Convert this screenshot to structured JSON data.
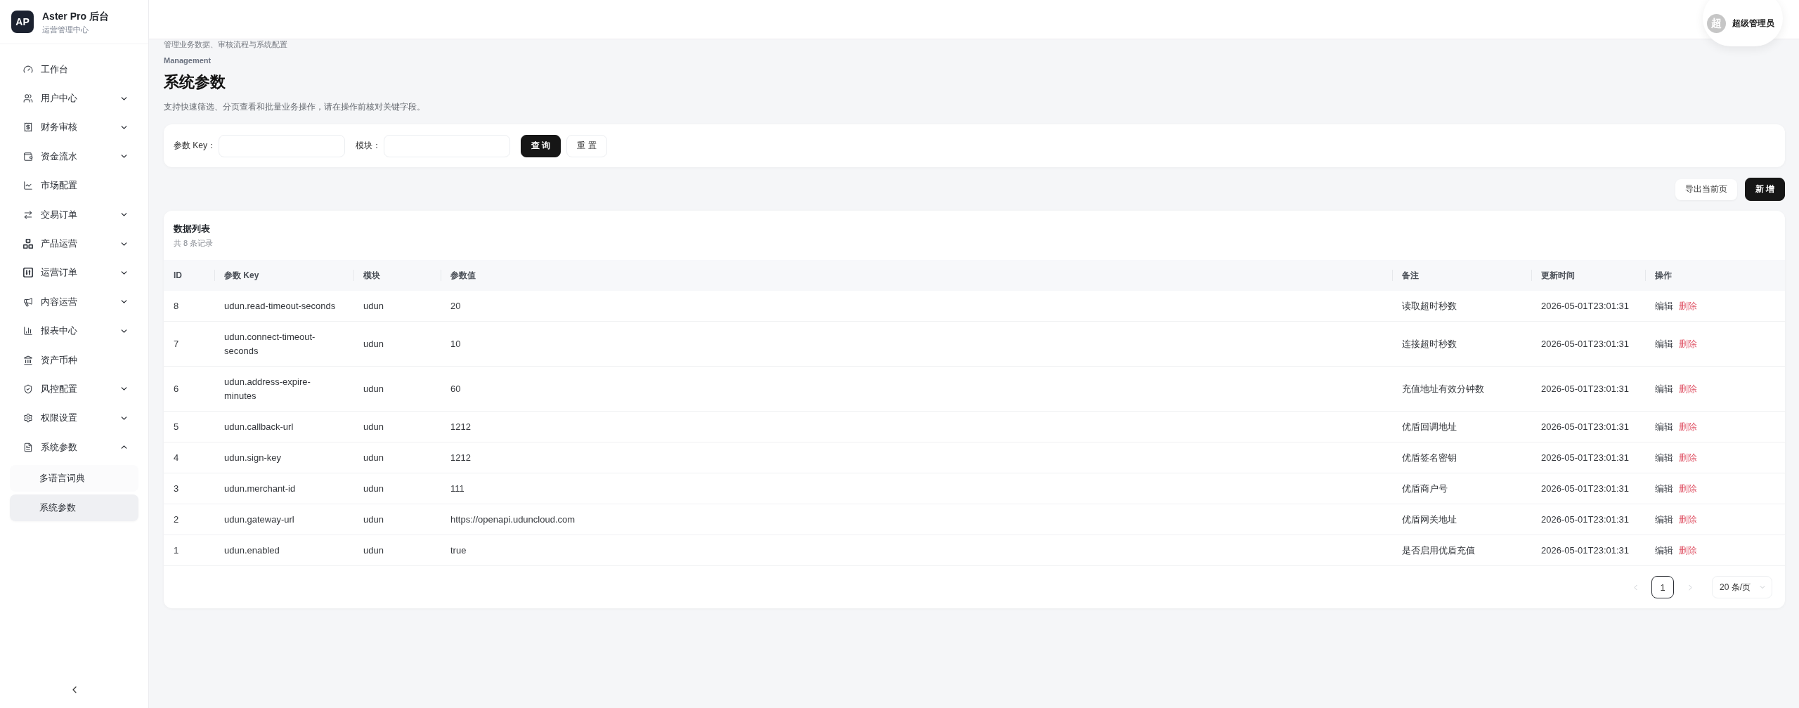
{
  "sidebar": {
    "logo": "AP",
    "title": "Aster Pro 后台",
    "subtitle": "运营管理中心",
    "items": [
      {
        "label": "工作台",
        "selected": false
      },
      {
        "label": "用户中心",
        "selected": false,
        "expanded": false
      },
      {
        "label": "财务审核",
        "selected": false,
        "expanded": false
      },
      {
        "label": "资金流水",
        "selected": false,
        "expanded": false
      },
      {
        "label": "市场配置",
        "selected": false
      },
      {
        "label": "交易订单",
        "selected": false,
        "expanded": false
      },
      {
        "label": "产品运营",
        "selected": false,
        "expanded": false
      },
      {
        "label": "运营订单",
        "selected": false,
        "expanded": false
      },
      {
        "label": "内容运营",
        "selected": false,
        "expanded": false
      },
      {
        "label": "报表中心",
        "selected": false,
        "expanded": false
      },
      {
        "label": "资产币种",
        "selected": false
      },
      {
        "label": "风控配置",
        "selected": false,
        "expanded": false
      },
      {
        "label": "权限设置",
        "selected": false,
        "expanded": false
      },
      {
        "label": "系统参数",
        "selected": false,
        "expanded": true,
        "children": [
          {
            "label": "多语言词典",
            "selected": false
          },
          {
            "label": "系统参数",
            "selected": true
          }
        ]
      }
    ]
  },
  "top_bar": {
    "user": {
      "avatar_text": "超",
      "name": "超级管理员"
    }
  },
  "page": {
    "subtitle": "管理业务数据、审核流程与系统配置",
    "eyebrow": "Management",
    "title": "系统参数",
    "description": "支持快速筛选、分页查看和批量业务操作，请在操作前核对关键字段。"
  },
  "filter": {
    "fields": [
      {
        "label": "参数 Key："
      },
      {
        "label": "模块："
      }
    ],
    "buttons": [
      {
        "label": "查 询",
        "kind": "primary"
      },
      {
        "label": "重 置",
        "kind": "default"
      }
    ]
  },
  "actions": [
    {
      "label": "导出当前页",
      "kind": "default"
    },
    {
      "label": "新 增",
      "kind": "primary"
    }
  ],
  "table": {
    "title": "数据列表",
    "count": "共 8 条记录",
    "columns": [
      "ID",
      "参数 Key",
      "模块",
      "参数值",
      "备注",
      "更新时间",
      "操作"
    ],
    "rows": [
      {
        "id": "8",
        "key": "udun.read-timeout-seconds",
        "module": "udun",
        "value": "20",
        "remark": "读取超时秒数",
        "updated": "2026-05-01T23:01:31",
        "actions": [
          {
            "label": "编辑",
            "kind": "edit"
          },
          {
            "label": "删除",
            "kind": "danger"
          }
        ]
      },
      {
        "id": "7",
        "key": "udun.connect-timeout-seconds",
        "module": "udun",
        "value": "10",
        "remark": "连接超时秒数",
        "updated": "2026-05-01T23:01:31",
        "actions": [
          {
            "label": "编辑",
            "kind": "edit"
          },
          {
            "label": "删除",
            "kind": "danger"
          }
        ]
      },
      {
        "id": "6",
        "key": "udun.address-expire-minutes",
        "module": "udun",
        "value": "60",
        "remark": "充值地址有效分钟数",
        "updated": "2026-05-01T23:01:31",
        "actions": [
          {
            "label": "编辑",
            "kind": "edit"
          },
          {
            "label": "删除",
            "kind": "danger"
          }
        ]
      },
      {
        "id": "5",
        "key": "udun.callback-url",
        "module": "udun",
        "value": "1212",
        "remark": "优盾回调地址",
        "updated": "2026-05-01T23:01:31",
        "actions": [
          {
            "label": "编辑",
            "kind": "edit"
          },
          {
            "label": "删除",
            "kind": "danger"
          }
        ]
      },
      {
        "id": "4",
        "key": "udun.sign-key",
        "module": "udun",
        "value": "1212",
        "remark": "优盾签名密钥",
        "updated": "2026-05-01T23:01:31",
        "actions": [
          {
            "label": "编辑",
            "kind": "edit"
          },
          {
            "label": "删除",
            "kind": "danger"
          }
        ]
      },
      {
        "id": "3",
        "key": "udun.merchant-id",
        "module": "udun",
        "value": "111",
        "remark": "优盾商户号",
        "updated": "2026-05-01T23:01:31",
        "actions": [
          {
            "label": "编辑",
            "kind": "edit"
          },
          {
            "label": "删除",
            "kind": "danger"
          }
        ]
      },
      {
        "id": "2",
        "key": "udun.gateway-url",
        "module": "udun",
        "value": "https://openapi.uduncloud.com",
        "remark": "优盾网关地址",
        "updated": "2026-05-01T23:01:31",
        "actions": [
          {
            "label": "编辑",
            "kind": "edit"
          },
          {
            "label": "删除",
            "kind": "danger"
          }
        ]
      },
      {
        "id": "1",
        "key": "udun.enabled",
        "module": "udun",
        "value": "true",
        "remark": "是否启用优盾充值",
        "updated": "2026-05-01T23:01:31",
        "actions": [
          {
            "label": "编辑",
            "kind": "edit"
          },
          {
            "label": "删除",
            "kind": "danger"
          }
        ]
      }
    ]
  },
  "pagination": {
    "prev_disabled": true,
    "pages": [
      {
        "label": "1",
        "selected": true
      }
    ],
    "next_disabled": true,
    "page_size": "20 条/页"
  }
}
